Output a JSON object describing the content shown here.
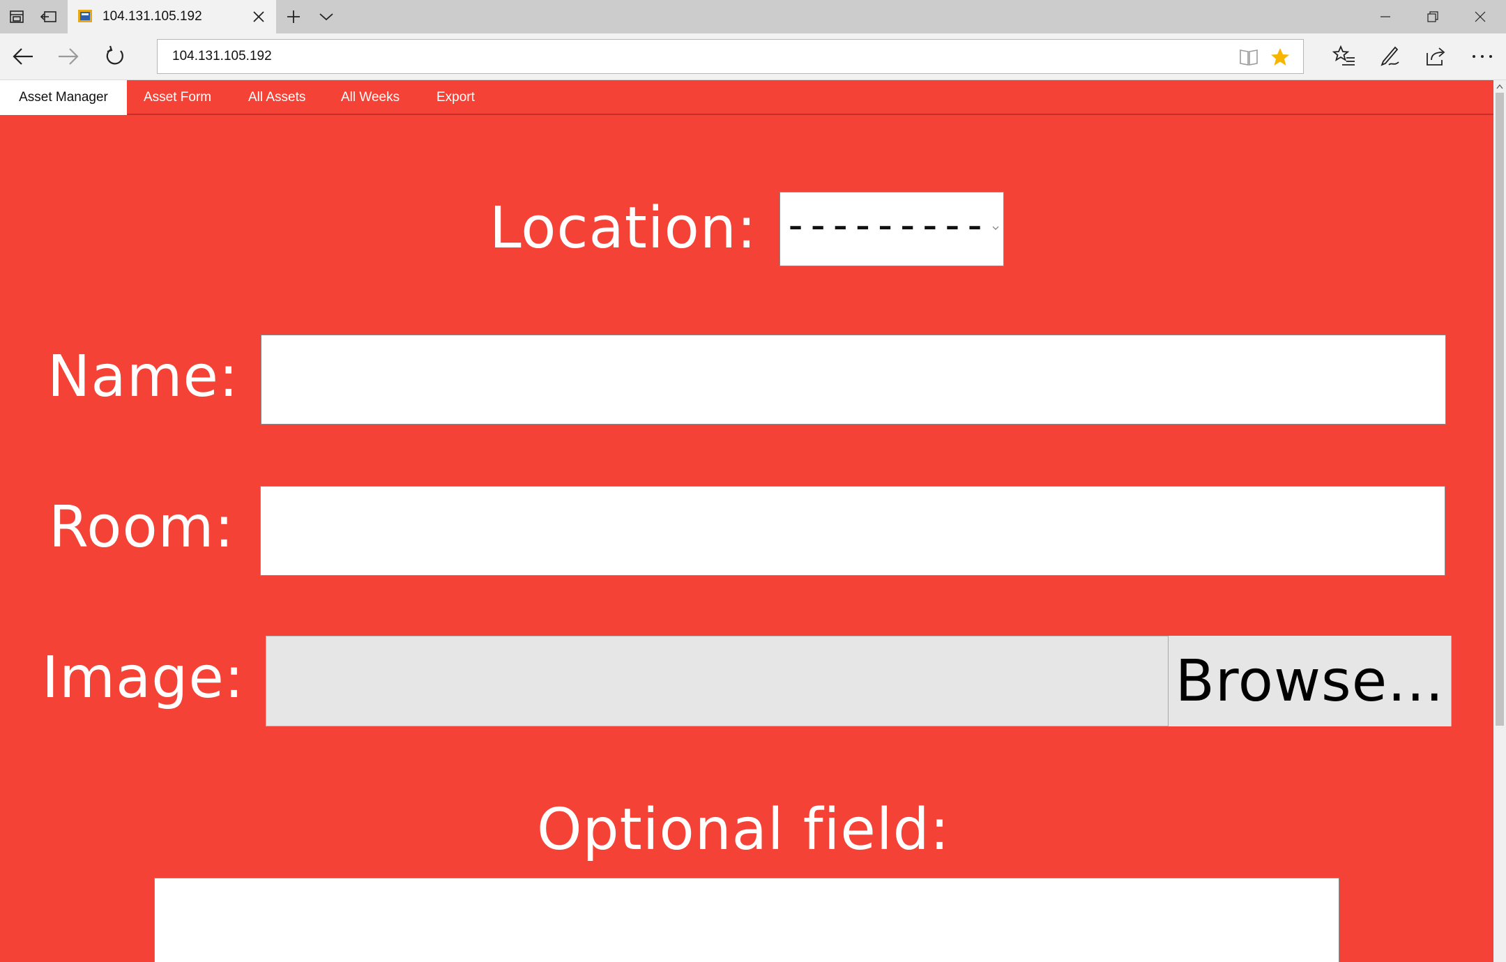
{
  "browser": {
    "tab_title": "104.131.105.192",
    "address": "104.131.105.192"
  },
  "topnav": {
    "brand": "Asset Manager",
    "items": [
      "Asset Form",
      "All Assets",
      "All Weeks",
      "Export"
    ]
  },
  "form": {
    "location_label": "Location:",
    "location_value": "---------",
    "name_label": "Name:",
    "name_value": "",
    "room_label": "Room:",
    "room_value": "",
    "image_label": "Image:",
    "browse_label": "Browse...",
    "optional_label": "Optional field:",
    "optional_value": ""
  },
  "colors": {
    "page_background": "#f44336",
    "favorite_star": "#f7b500"
  }
}
